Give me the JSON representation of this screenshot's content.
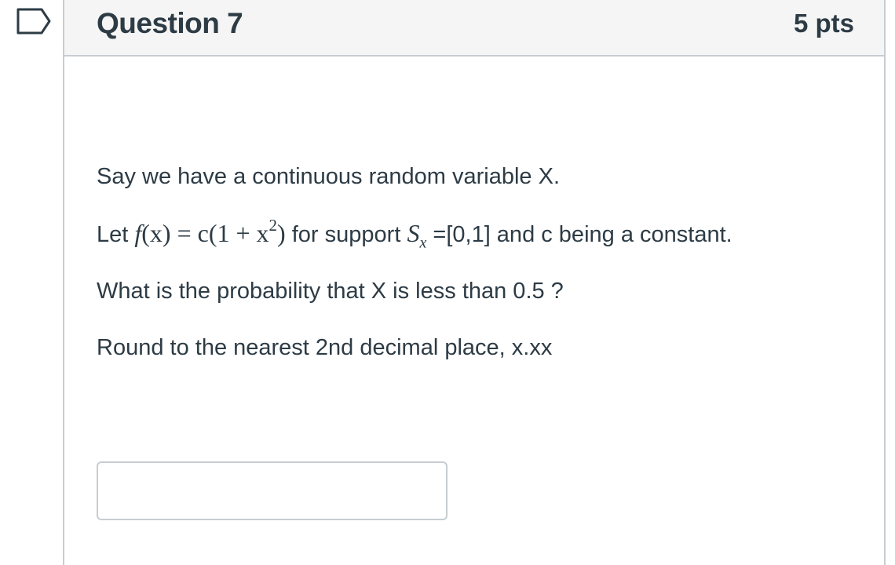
{
  "question": {
    "title": "Question 7",
    "points": "5 pts",
    "lines": {
      "line1": "Say we have a continuous random variable X.",
      "line2_pre": "Let ",
      "line2_math_f": "f",
      "line2_math_rest": "(x) = c(1 + x",
      "line2_math_exp": "2",
      "line2_math_close": ")",
      "line2_mid": " for support ",
      "line2_math_S": "S",
      "line2_math_sub": "x",
      "line2_post": " =[0,1] and c being a constant.",
      "line3": "What is the probability that X is less than 0.5 ?",
      "line4": "Round to the nearest 2nd decimal place, x.xx"
    },
    "answer": {
      "value": "",
      "placeholder": ""
    }
  },
  "icons": {
    "flag": "bookmark-flag-icon"
  },
  "colors": {
    "text": "#2d3b45",
    "border": "#c7cdd1",
    "header_bg": "#f5f5f5"
  }
}
